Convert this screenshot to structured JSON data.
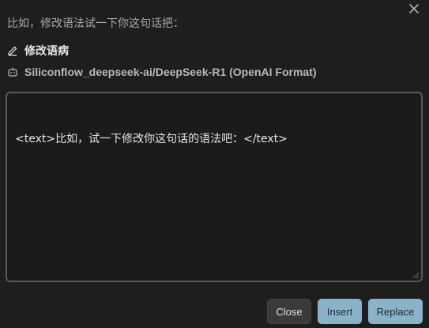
{
  "dialog": {
    "instruction": "比如，修改语法试一下你这句话把：",
    "prompt_name": "修改语病",
    "model_name": "Siliconflow_deepseek-ai/DeepSeek-R1 (OpenAI Format)",
    "editor_text": "<text>比如，试一下修改你这句话的语法吧：</text>"
  },
  "buttons": {
    "close": "Close",
    "insert": "Insert",
    "replace": "Replace"
  },
  "icons": {
    "close": "close-icon",
    "prompt": "pencil-icon",
    "model": "robot-icon"
  },
  "colors": {
    "background": "#1e1e1e",
    "accent_button": "#8ab2c8",
    "secondary_button": "#3a3a3a"
  }
}
